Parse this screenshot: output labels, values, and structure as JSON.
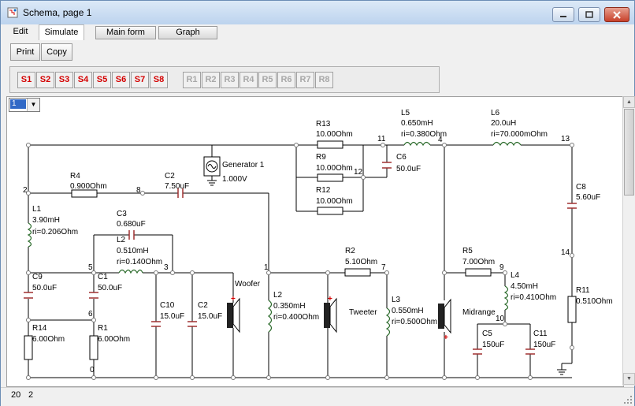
{
  "window": {
    "title": "Schema, page 1"
  },
  "menu": {
    "edit": "Edit",
    "simulate": "Simulate",
    "main_form": "Main form",
    "graph": "Graph"
  },
  "toolbar": {
    "print": "Print",
    "copy": "Copy",
    "s_buttons": [
      "S1",
      "S2",
      "S3",
      "S4",
      "S5",
      "S6",
      "S7",
      "S8"
    ],
    "r_buttons": [
      "R1",
      "R2",
      "R3",
      "R4",
      "R5",
      "R6",
      "R7",
      "R8"
    ],
    "s_color": "#d40000",
    "r_color": "#a8a8a8"
  },
  "page_select": {
    "value": "1"
  },
  "status": {
    "x": "20",
    "y": "2"
  },
  "schematic": {
    "nodes": {
      "n0": "0",
      "n1": "1",
      "n2": "2",
      "n3": "3",
      "n4": "4",
      "n5": "5",
      "n6": "6",
      "n7": "7",
      "n8": "8",
      "n9": "9",
      "n10": "10",
      "n11": "11",
      "n12": "12",
      "n13": "13",
      "n14": "14"
    },
    "generator": {
      "name": "Generator 1",
      "value": "1.000V"
    },
    "r13": {
      "name": "R13",
      "value": "10.00Ohm"
    },
    "r9": {
      "name": "R9",
      "value": "10.00Ohm"
    },
    "r12": {
      "name": "R12",
      "value": "10.00Ohm"
    },
    "r4": {
      "name": "R4",
      "value": "0.900Ohm"
    },
    "c2a": {
      "name": "C2",
      "value": "7.50uF"
    },
    "c6": {
      "name": "C6",
      "value": "50.0uF"
    },
    "l5": {
      "name": "L5",
      "value": "0.650mH",
      "ri": "ri=0.380Ohm"
    },
    "l6": {
      "name": "L6",
      "value": "20.0uH",
      "ri": "ri=70.000mOhm"
    },
    "c8": {
      "name": "C8",
      "value": "5.60uF"
    },
    "l1": {
      "name": "L1",
      "value": "3.90mH",
      "ri": "ri=0.206Ohm"
    },
    "c3": {
      "name": "C3",
      "value": "0.680uF"
    },
    "l2a": {
      "name": "L2",
      "value": "0.510mH",
      "ri": "ri=0.140Ohm"
    },
    "c9": {
      "name": "C9",
      "value": "50.0uF"
    },
    "c1": {
      "name": "C1",
      "value": "50.0uF"
    },
    "c10": {
      "name": "C10",
      "value": "15.0uF"
    },
    "c2b": {
      "name": "C2",
      "value": "15.0uF"
    },
    "woofer": "Woofer",
    "l2b": {
      "name": "L2",
      "value": "0.350mH",
      "ri": "ri=0.400Ohm"
    },
    "r2": {
      "name": "R2",
      "value": "5.10Ohm"
    },
    "tweeter": "Tweeter",
    "l3": {
      "name": "L3",
      "value": "0.550mH",
      "ri": "ri=0.500Ohm"
    },
    "r5": {
      "name": "R5",
      "value": "7.00Ohm"
    },
    "l4": {
      "name": "L4",
      "value": "4.50mH",
      "ri": "ri=0.410Ohm"
    },
    "midrange": "Midrange",
    "c5": {
      "name": "C5",
      "value": "150uF"
    },
    "c11": {
      "name": "C11",
      "value": "150uF"
    },
    "r11": {
      "name": "R11",
      "value": "0.510Ohm"
    },
    "r14": {
      "name": "R14",
      "value": "6.00Ohm"
    },
    "r1": {
      "name": "R1",
      "value": "6.00Ohm"
    }
  }
}
